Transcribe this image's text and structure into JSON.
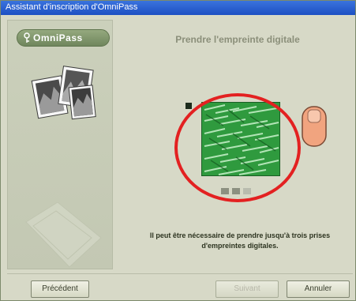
{
  "window": {
    "title": "Assistant d'inscription d'OmniPass"
  },
  "sidebar": {
    "logo_text": "OmniPass"
  },
  "main": {
    "title": "Prendre l'empreinte digitale",
    "message_line1": "Il peut être nécessaire de prendre jusqu'à trois prises",
    "message_line2": "d'empreintes digitales."
  },
  "footer": {
    "previous_label": "Précédent",
    "next_label": "Suivant",
    "cancel_label": "Annuler"
  },
  "colors": {
    "title_bar": "#2a5fd0",
    "highlight_circle": "#e32121",
    "fingerprint_green": "#2f9a3e"
  }
}
